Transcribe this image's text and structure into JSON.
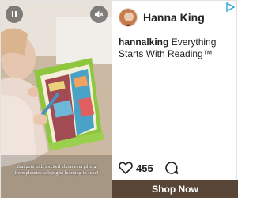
{
  "video": {
    "caption": "that gets kids excited about everything from phonics solving to learning to read!",
    "pause_icon": "pause-icon",
    "mute_icon": "mute-icon"
  },
  "profile": {
    "name": "Hanna King"
  },
  "post": {
    "handle": "hannalking",
    "text": "Everything Starts With Reading™"
  },
  "actions": {
    "likes": "455",
    "like_icon": "heart-icon",
    "comment_icon": "comment-icon"
  },
  "cta": {
    "label": "Shop Now"
  },
  "colors": {
    "cta_bg": "#5a4636",
    "adchoices": "#2ba5d8"
  }
}
